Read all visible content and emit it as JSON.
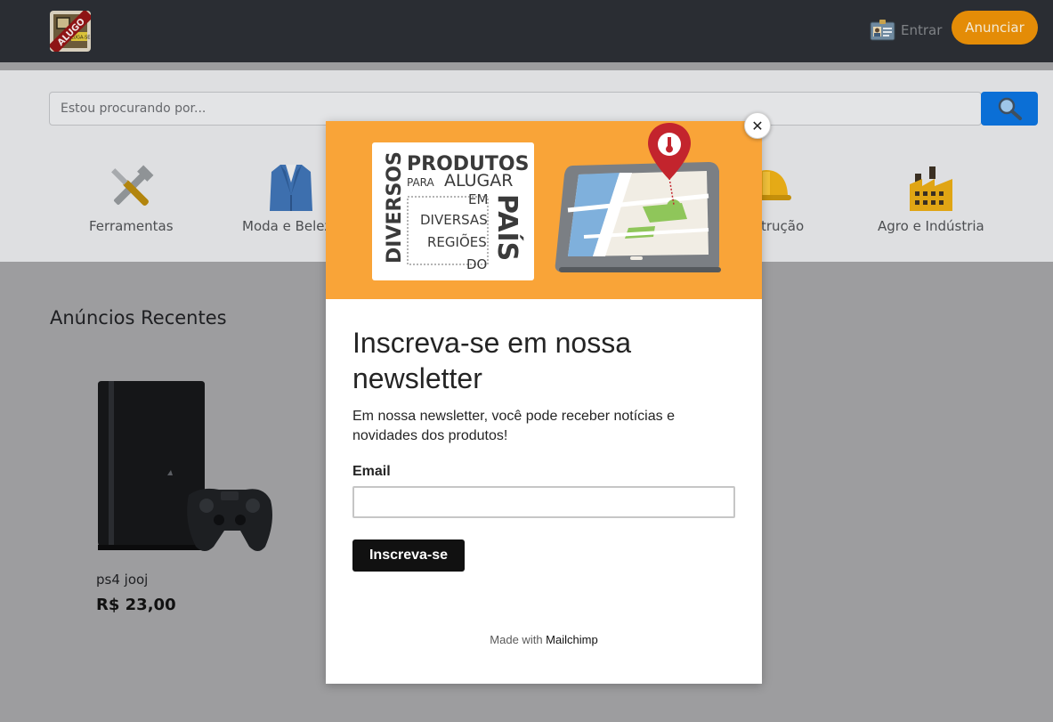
{
  "header": {
    "logo_text": "ALUGO",
    "logo_sign": "ALUGA-SE",
    "login_label": "Entrar",
    "login_icon": "id-card-icon",
    "cta_label": "Anunciar",
    "accent": "#e48c07"
  },
  "search": {
    "placeholder": "Estou procurando por...",
    "button_icon": "search-icon"
  },
  "categories": [
    {
      "label": "Ferramentas",
      "icon": "tools-icon"
    },
    {
      "label": "Moda e Beleza",
      "icon": "blazer-icon"
    },
    {
      "label": "Construção",
      "icon": "hard-hat-icon"
    },
    {
      "label": "Agro e Indústria",
      "icon": "factory-icon"
    }
  ],
  "recent": {
    "title": "Anúncios Recentes",
    "items": [
      {
        "name": "ps4 jooj",
        "price": "R$ 23,00",
        "image": "ps4-console-image"
      }
    ]
  },
  "modal": {
    "banner": {
      "word_diversos": "DIVERSOS",
      "word_produtos": "PRODUTOS",
      "word_para": "PARA",
      "word_alugar": "ALUGAR",
      "word_em": "EM",
      "word_diversas": "DIVERSAS",
      "word_regioes": "REGIÕES",
      "word_do": "DO",
      "word_pais": "PAÍS",
      "background": "#f9a438"
    },
    "title": "Inscreva-se em nossa newsletter",
    "description": "Em nossa newsletter, você pode receber notícias e novidades dos produtos!",
    "email_label": "Email",
    "email_value": "",
    "submit_label": "Inscreva-se",
    "footer_prefix": "Made with",
    "footer_brand": "Mailchimp",
    "close_label": "✕"
  }
}
